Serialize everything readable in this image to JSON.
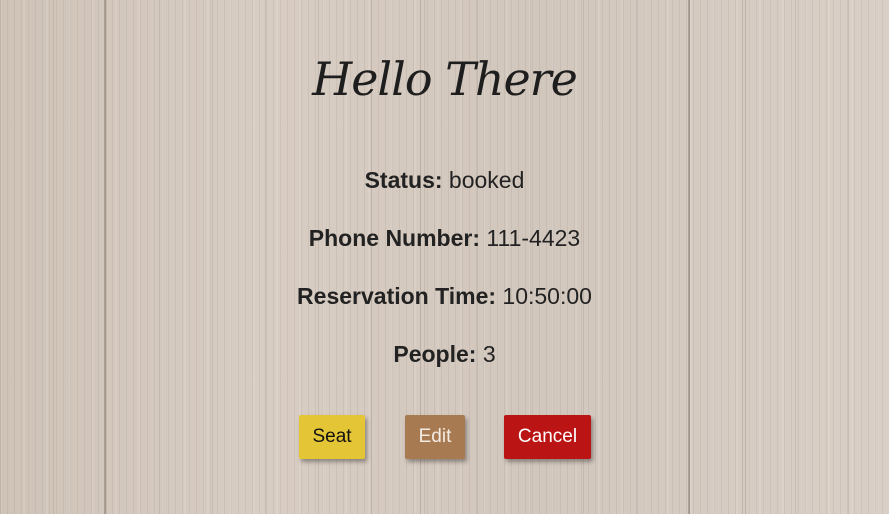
{
  "greeting": "Hello There",
  "fields": {
    "status": {
      "label": "Status:",
      "value": " booked"
    },
    "phone": {
      "label": "Phone Number:",
      "value": " 111-4423"
    },
    "time": {
      "label": "Reservation Time:",
      "value": " 10:50:00"
    },
    "people": {
      "label": "People:",
      "value": " 3"
    }
  },
  "buttons": {
    "seat": {
      "label": "Seat",
      "color": "#e4c536"
    },
    "edit": {
      "label": "Edit",
      "color": "#a87a52"
    },
    "cancel": {
      "label": "Cancel",
      "color": "#bb1414"
    }
  },
  "background": "wood-texture"
}
